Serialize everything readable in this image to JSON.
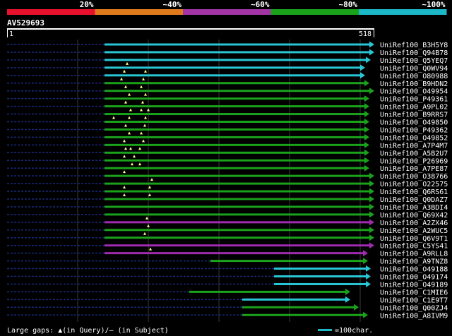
{
  "legend": {
    "labels": [
      "20%",
      "~40%",
      "~60%",
      "~80%",
      "~100%"
    ],
    "colors": [
      "#e8112d",
      "#e07b1c",
      "#a234a6",
      "#1ba21b",
      "#1cb8c8"
    ]
  },
  "query": {
    "id": "AV529693",
    "start_label": "1",
    "end_label": "518"
  },
  "footer": {
    "gaps_text": "Large gaps: ▲(in Query)/– (in Subject)",
    "scale_text": "=100char."
  },
  "hits": [
    {
      "name": "UniRef100_B3H5Y8",
      "color": "cyan",
      "start": 148,
      "end": 530,
      "marks": []
    },
    {
      "name": "UniRef100_Q94B78",
      "color": "cyan",
      "start": 148,
      "end": 530,
      "marks": []
    },
    {
      "name": "UniRef100_Q5YEQ7",
      "color": "cyan",
      "start": 148,
      "end": 525,
      "marks": []
    },
    {
      "name": "UniRef100_Q0WV94",
      "color": "cyan",
      "start": 148,
      "end": 517,
      "marks": [
        180
      ]
    },
    {
      "name": "UniRef100_O80988",
      "color": "cyan",
      "start": 148,
      "end": 517,
      "marks": [
        176,
        206
      ]
    },
    {
      "name": "UniRef100_B9HDN2",
      "color": "green",
      "start": 148,
      "end": 523,
      "marks": [
        172,
        203
      ]
    },
    {
      "name": "UniRef100_O49954",
      "color": "green",
      "start": 148,
      "end": 530,
      "marks": [
        178,
        200
      ]
    },
    {
      "name": "UniRef100_P49361",
      "color": "green",
      "start": 148,
      "end": 523,
      "marks": [
        183,
        206
      ]
    },
    {
      "name": "UniRef100_A9PL02",
      "color": "green",
      "start": 148,
      "end": 523,
      "marks": [
        178,
        202
      ]
    },
    {
      "name": "UniRef100_B9RRS7",
      "color": "green",
      "start": 148,
      "end": 523,
      "marks": [
        185,
        200,
        210
      ]
    },
    {
      "name": "UniRef100_O49850",
      "color": "green",
      "start": 148,
      "end": 523,
      "marks": [
        161,
        183,
        206
      ]
    },
    {
      "name": "UniRef100_P49362",
      "color": "green",
      "start": 148,
      "end": 523,
      "marks": [
        178,
        205
      ]
    },
    {
      "name": "UniRef100_O49852",
      "color": "green",
      "start": 148,
      "end": 523,
      "marks": [
        183,
        200
      ]
    },
    {
      "name": "UniRef100_A7P4M7",
      "color": "green",
      "start": 148,
      "end": 523,
      "marks": [
        176,
        203
      ]
    },
    {
      "name": "UniRef100_A5B2U7",
      "color": "green",
      "start": 148,
      "end": 523,
      "marks": [
        178,
        185,
        198
      ]
    },
    {
      "name": "UniRef100_P26969",
      "color": "green",
      "start": 148,
      "end": 523,
      "marks": [
        176,
        190
      ]
    },
    {
      "name": "UniRef100_A7PE87",
      "color": "green",
      "start": 148,
      "end": 523,
      "marks": [
        187,
        198
      ]
    },
    {
      "name": "UniRef100_O38766",
      "color": "green",
      "start": 148,
      "end": 530,
      "marks": [
        176
      ]
    },
    {
      "name": "UniRef100_O22575",
      "color": "green",
      "start": 148,
      "end": 530,
      "marks": [
        215
      ]
    },
    {
      "name": "UniRef100_Q6RS61",
      "color": "green",
      "start": 148,
      "end": 530,
      "marks": [
        176,
        212
      ]
    },
    {
      "name": "UniRef100_Q0DAZ7",
      "color": "green",
      "start": 148,
      "end": 530,
      "marks": [
        176,
        212
      ]
    },
    {
      "name": "UniRef100_A3BDI4",
      "color": "green",
      "start": 148,
      "end": 530,
      "marks": []
    },
    {
      "name": "UniRef100_Q69X42",
      "color": "green",
      "start": 148,
      "end": 530,
      "marks": []
    },
    {
      "name": "UniRef100_A2ZX46",
      "color": "purple",
      "start": 148,
      "end": 530,
      "marks": [
        208
      ]
    },
    {
      "name": "UniRef100_A2WUC5",
      "color": "green",
      "start": 148,
      "end": 530,
      "marks": [
        210
      ]
    },
    {
      "name": "UniRef100_Q6V9T1",
      "color": "green",
      "start": 148,
      "end": 530,
      "marks": [
        205
      ]
    },
    {
      "name": "UniRef100_C5YS41",
      "color": "purple",
      "start": 148,
      "end": 530,
      "marks": []
    },
    {
      "name": "UniRef100_A9RLL8",
      "color": "purple",
      "start": 148,
      "end": 521,
      "marks": [
        213
      ]
    },
    {
      "name": "UniRef100_A9TNZ8",
      "color": "green",
      "start": 298,
      "end": 521,
      "marks": []
    },
    {
      "name": "UniRef100_O49188",
      "color": "cyan",
      "start": 388,
      "end": 525,
      "marks": []
    },
    {
      "name": "UniRef100_O49174",
      "color": "cyan",
      "start": 388,
      "end": 525,
      "marks": []
    },
    {
      "name": "UniRef100_O49189",
      "color": "cyan",
      "start": 388,
      "end": 525,
      "marks": []
    },
    {
      "name": "UniRef100_C1MIE6",
      "color": "green",
      "start": 268,
      "end": 496,
      "marks": []
    },
    {
      "name": "UniRef100_C1E9T7",
      "color": "cyan",
      "start": 343,
      "end": 496,
      "marks": []
    },
    {
      "name": "UniRef100_Q00ZJ4",
      "color": "green",
      "start": 343,
      "end": 508,
      "marks": []
    },
    {
      "name": "UniRef100_A8IVM9",
      "color": "green",
      "start": 343,
      "end": 521,
      "marks": []
    }
  ]
}
